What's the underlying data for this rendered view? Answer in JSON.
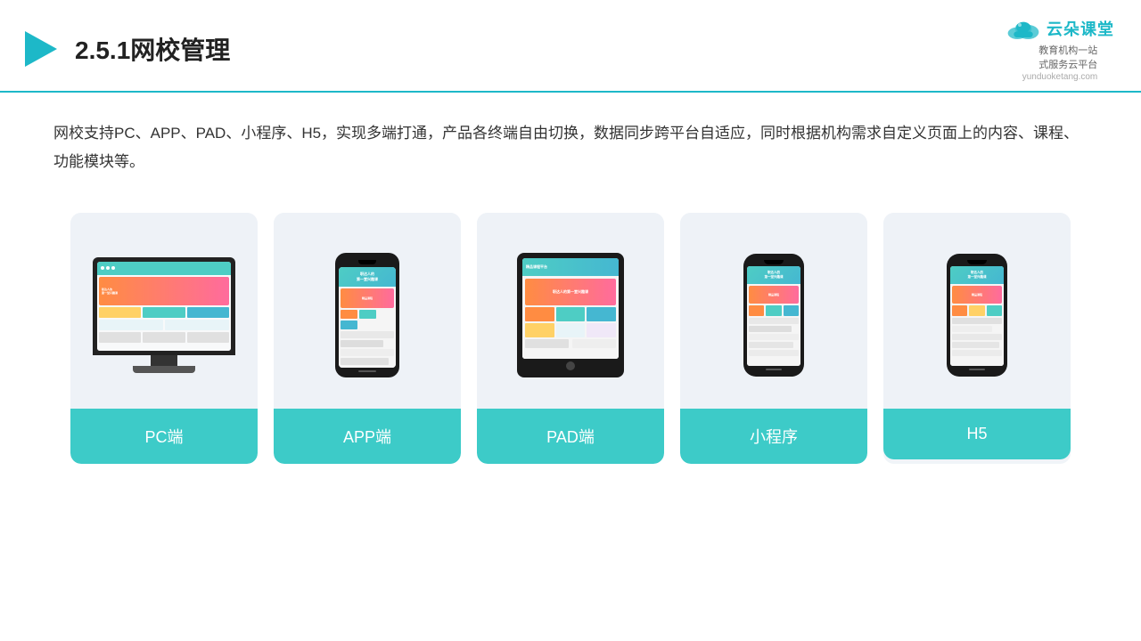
{
  "header": {
    "title": "2.5.1网校管理",
    "logo_name": "云朵课堂",
    "logo_url": "yunduoketang.com",
    "logo_subtitle": "教育机构一站\n式服务云平台"
  },
  "description": {
    "text": "网校支持PC、APP、PAD、小程序、H5，实现多端打通，产品各终端自由切换，数据同步跨平台自适应，同时根据机构需求自定义页面上的内容、课程、功能模块等。"
  },
  "cards": [
    {
      "id": "pc",
      "label": "PC端"
    },
    {
      "id": "app",
      "label": "APP端"
    },
    {
      "id": "pad",
      "label": "PAD端"
    },
    {
      "id": "miniprogram",
      "label": "小程序"
    },
    {
      "id": "h5",
      "label": "H5"
    }
  ],
  "colors": {
    "accent": "#3dcbc8",
    "header_border": "#1db8c8",
    "title_color": "#222",
    "card_bg": "#eef2f7",
    "label_bg": "#3dcbc8"
  }
}
